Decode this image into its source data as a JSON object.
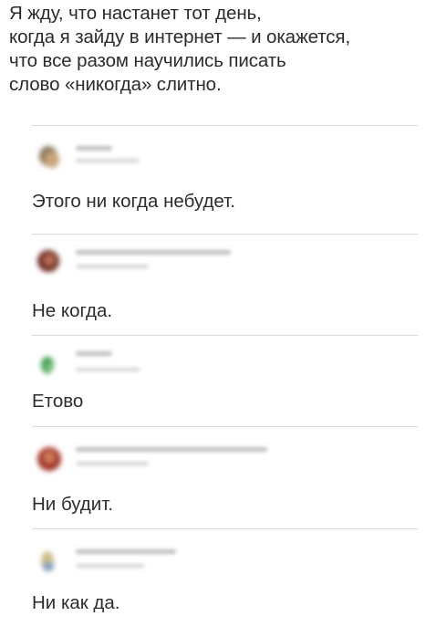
{
  "post": {
    "lines": [
      "Я жду, что настанет тот день,",
      "когда я зайду в интернет — и окажется,",
      "что все разом научились писать",
      "слово «никогда» слитно."
    ]
  },
  "comments": [
    {
      "text": "Этого ни когда небудет."
    },
    {
      "text": "Не когда."
    },
    {
      "text": "Етово"
    },
    {
      "text": "Ни будит."
    },
    {
      "text": "Ни как да."
    }
  ]
}
